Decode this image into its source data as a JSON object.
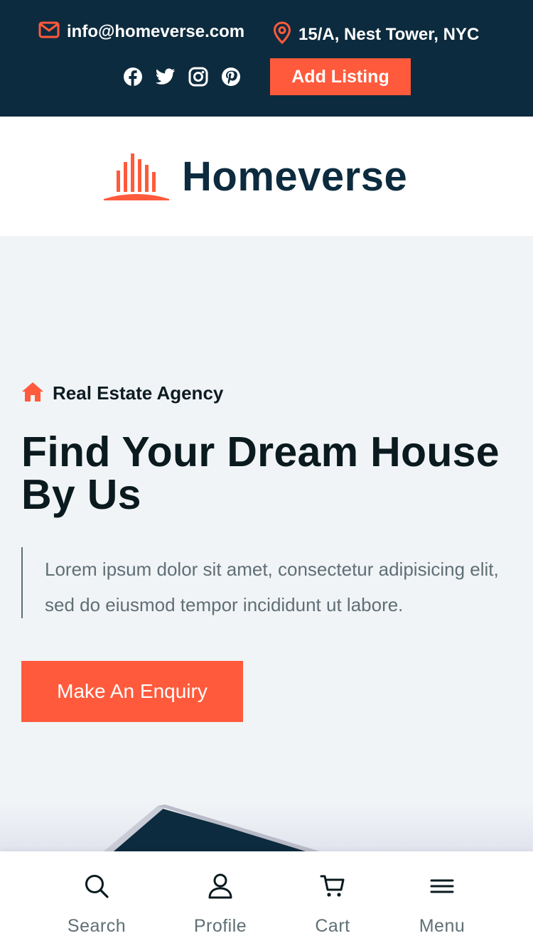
{
  "topbar": {
    "email": "info@homeverse.com",
    "address": "15/A, Nest Tower, NYC",
    "socials": [
      "facebook",
      "twitter",
      "instagram",
      "pinterest"
    ],
    "add_listing_label": "Add Listing"
  },
  "brand": {
    "name": "Homeverse"
  },
  "hero": {
    "tag": "Real Estate Agency",
    "title": "Find Your Dream House By Us",
    "text": "Lorem ipsum dolor sit amet, consectetur adipisicing elit, sed do eiusmod tempor incididunt ut labore.",
    "cta_label": "Make An Enquiry"
  },
  "bottom_nav": {
    "items": [
      {
        "label": "Search",
        "icon": "search-icon"
      },
      {
        "label": "Profile",
        "icon": "user-icon"
      },
      {
        "label": "Cart",
        "icon": "cart-icon"
      },
      {
        "label": "Menu",
        "icon": "menu-icon"
      }
    ]
  },
  "colors": {
    "accent": "#ff5a3c",
    "navy": "#0d2b3e",
    "muted": "#5f6f75",
    "hero_bg": "#f1f4f6"
  }
}
